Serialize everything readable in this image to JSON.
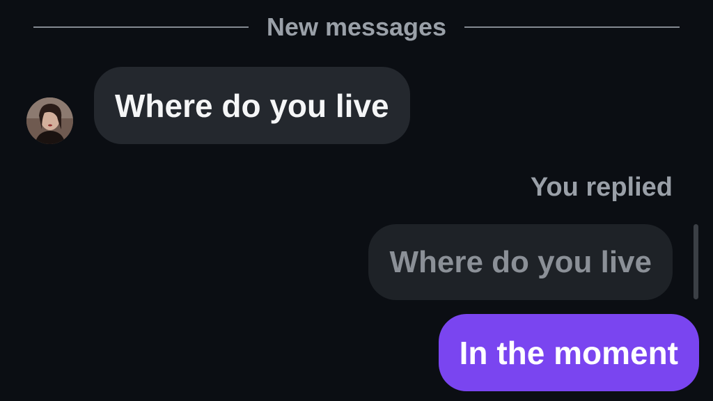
{
  "divider": {
    "label": "New messages"
  },
  "thread": {
    "incoming_message": "Where do you live",
    "reply_context_label": "You replied",
    "quoted_message": "Where do you live",
    "outgoing_message": "In the moment"
  },
  "colors": {
    "background": "#0b0e13",
    "incoming_bubble": "#24282e",
    "quoted_bubble": "#1e2227",
    "outgoing_bubble": "#7a45f0",
    "muted_text": "#9aa0a8"
  },
  "icons": {
    "avatar": "user-avatar-photo"
  }
}
